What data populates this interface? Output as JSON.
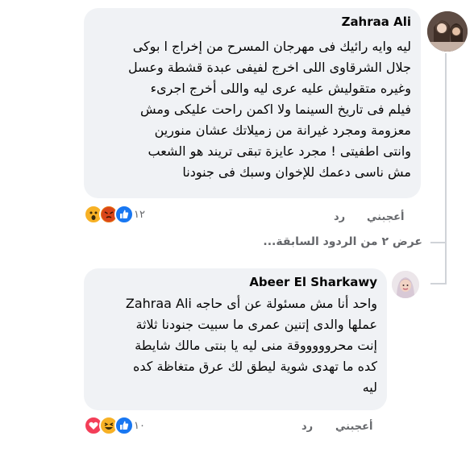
{
  "comments": [
    {
      "author": "Zahraa Ali",
      "lines": [
        "ليه وايه رائيك فى مهرجان المسرح من إخراج ا بوكى",
        "جلال الشرقاوى اللى اخرج لفيفى عبدة قشطة وعسل",
        "وغيره متقوليش عليه عرى ليه واللى أخرج اجرىء",
        "فيلم فى تاريخ السينما ولا اكمن راحت عليكى ومش",
        "معزومة ومجرد غيرانة من زميلاتك  عشان منورين",
        "وانتى اطفيتى ! مجرد عايزة تبقى تريند هو الشعب",
        "مش ناسى دعمك للإخوان وسبك فى جنودنا"
      ],
      "like_label": "أعجبني",
      "reply_label": "رد",
      "reaction_count": "١٢",
      "reactions": [
        "like-icon",
        "angry-icon",
        "wow-icon"
      ]
    },
    {
      "author": "Abeer El Sharkawy",
      "lines": [
        "واحد أنا مش مسئولة عن أى حاجه Zahraa Ali",
        "عملها والدى إتنين عمرى ما سبيت جنودنا ثلاثة",
        "إنت محروووووقة منى ليه يا بنتى مالك شايطة",
        "كده ما تهدى شوية ليطق لك عرق متغاظة كده",
        "ليه"
      ],
      "like_label": "أعجبني",
      "reply_label": "رد",
      "reaction_count": "١٠",
      "reactions": [
        "like-icon",
        "haha-icon",
        "love-icon"
      ]
    }
  ],
  "view_previous_replies": "عرض ٢ من الردود السابقة..."
}
